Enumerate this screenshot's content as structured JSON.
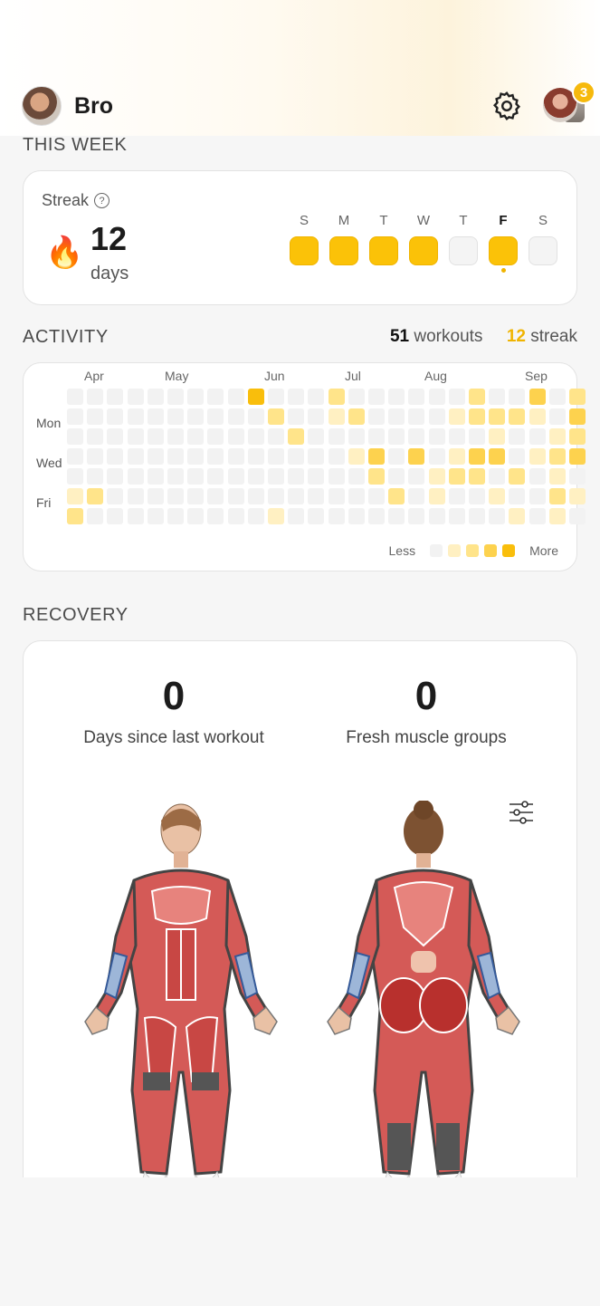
{
  "header": {
    "username": "Bro",
    "notification_count": "3"
  },
  "this_week": {
    "section_title": "THIS WEEK",
    "streak_label": "Streak",
    "streak_value": "12",
    "streak_unit": "days",
    "days": [
      {
        "letter": "S",
        "done": true,
        "today": false
      },
      {
        "letter": "M",
        "done": true,
        "today": false
      },
      {
        "letter": "T",
        "done": true,
        "today": false
      },
      {
        "letter": "W",
        "done": true,
        "today": false
      },
      {
        "letter": "T",
        "done": false,
        "today": false
      },
      {
        "letter": "F",
        "done": true,
        "today": true
      },
      {
        "letter": "S",
        "done": false,
        "today": false
      }
    ]
  },
  "activity": {
    "section_title": "ACTIVITY",
    "workouts_count": "51",
    "workouts_label": "workouts",
    "streak_count": "12",
    "streak_label": "streak",
    "months": [
      "Apr",
      "May",
      "Jun",
      "Jul",
      "Aug",
      "Sep"
    ],
    "weekday_labels": [
      "Mon",
      "Wed",
      "Fri"
    ],
    "legend_less": "Less",
    "legend_more": "More",
    "levels_colors": [
      "#f2f2f2",
      "#fff0c2",
      "#ffe48a",
      "#fdd24e",
      "#f9be0c"
    ],
    "heatmap": [
      [
        0,
        0,
        0,
        0,
        0,
        0,
        0,
        0,
        0,
        4,
        0,
        0,
        0,
        2,
        0,
        0,
        0,
        0,
        0,
        0,
        2,
        0,
        0,
        3,
        0,
        2
      ],
      [
        0,
        0,
        0,
        0,
        0,
        0,
        0,
        0,
        0,
        0,
        2,
        0,
        0,
        1,
        2,
        0,
        0,
        0,
        0,
        1,
        2,
        2,
        2,
        1,
        0,
        3
      ],
      [
        0,
        0,
        0,
        0,
        0,
        0,
        0,
        0,
        0,
        0,
        0,
        2,
        0,
        0,
        0,
        0,
        0,
        0,
        0,
        0,
        0,
        1,
        0,
        0,
        1,
        2
      ],
      [
        0,
        0,
        0,
        0,
        0,
        0,
        0,
        0,
        0,
        0,
        0,
        0,
        0,
        0,
        1,
        3,
        0,
        3,
        0,
        1,
        3,
        3,
        0,
        1,
        2,
        3
      ],
      [
        0,
        0,
        0,
        0,
        0,
        0,
        0,
        0,
        0,
        0,
        0,
        0,
        0,
        0,
        0,
        2,
        0,
        0,
        1,
        2,
        2,
        0,
        2,
        0,
        1,
        0
      ],
      [
        1,
        2,
        0,
        0,
        0,
        0,
        0,
        0,
        0,
        0,
        0,
        0,
        0,
        0,
        0,
        0,
        2,
        0,
        1,
        0,
        0,
        1,
        0,
        0,
        2,
        1
      ],
      [
        2,
        0,
        0,
        0,
        0,
        0,
        0,
        0,
        0,
        0,
        1,
        0,
        0,
        0,
        0,
        0,
        0,
        0,
        0,
        0,
        0,
        0,
        1,
        0,
        1,
        0
      ]
    ]
  },
  "recovery": {
    "section_title": "RECOVERY",
    "days_since": "0",
    "days_since_label": "Days since last workout",
    "fresh_groups": "0",
    "fresh_groups_label": "Fresh muscle groups"
  }
}
